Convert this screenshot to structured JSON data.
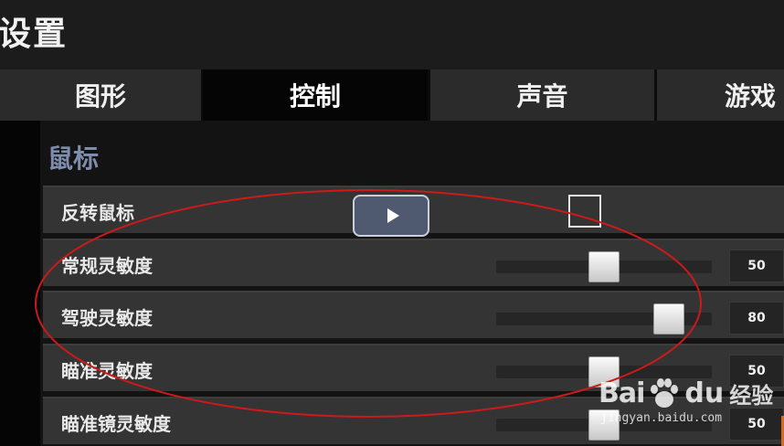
{
  "header": {
    "title": "设置"
  },
  "tabs": [
    {
      "label": "图形",
      "active": false
    },
    {
      "label": "控制",
      "active": true
    },
    {
      "label": "声音",
      "active": false
    },
    {
      "label": "游戏",
      "active": false
    }
  ],
  "section": {
    "title": "鼠标"
  },
  "settings": [
    {
      "label": "反转鼠标",
      "type": "checkbox",
      "checked": false
    },
    {
      "label": "常规灵敏度",
      "type": "slider",
      "value": "50",
      "level": 0.5
    },
    {
      "label": "驾驶灵敏度",
      "type": "slider",
      "value": "80",
      "level": 0.8
    },
    {
      "label": "瞄准灵敏度",
      "type": "slider",
      "value": "50",
      "level": 0.5
    },
    {
      "label": "瞄准镜灵敏度",
      "type": "slider",
      "value": "50",
      "level": 0.5
    }
  ],
  "video_overlay": {
    "icon": "play-icon"
  },
  "annotation": {
    "shape": "red-ellipse",
    "color": "#cc1a1a"
  },
  "watermark": {
    "brand_bai": "Bai",
    "brand_du": "du",
    "brand_jingyan": "经验",
    "url": "jingyan.baidu.com",
    "paw_icon": "baidu-paw-icon"
  },
  "colors": {
    "section_title": "#7e8dac",
    "row_bg": "#343434",
    "active_tab_bg": "#050505"
  }
}
